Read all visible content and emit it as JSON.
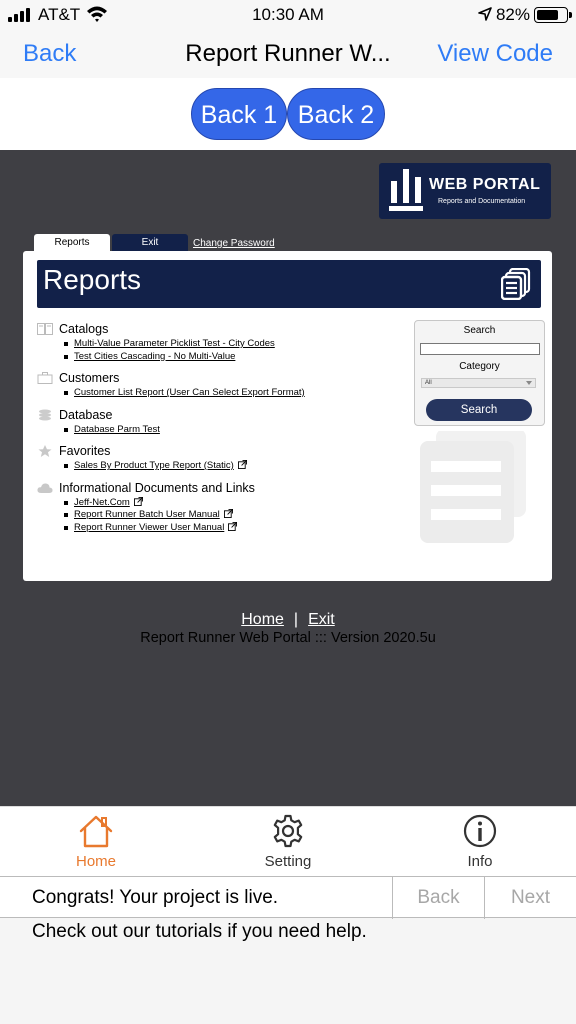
{
  "status_bar": {
    "carrier": "AT&T",
    "time": "10:30 AM",
    "battery_percent": "82%",
    "battery_level": 0.82
  },
  "nav_bar": {
    "back_label": "Back",
    "title": "Report Runner W...",
    "view_code_label": "View Code"
  },
  "top_buttons": {
    "back1_label": "Back 1",
    "back2_label": "Back 2"
  },
  "portal": {
    "logo_title": "WEB PORTAL",
    "logo_subtitle": "Reports and Documentation",
    "tabs": {
      "reports": "Reports",
      "exit": "Exit",
      "change_password": "Change Password"
    },
    "banner_title": "Reports",
    "categories": [
      {
        "name": "Catalogs",
        "icon": "book-icon",
        "items": [
          {
            "label": "Multi-Value Parameter Picklist Test - City Codes",
            "external": false
          },
          {
            "label": "Test Cities Cascading - No Multi-Value",
            "external": false
          }
        ]
      },
      {
        "name": "Customers",
        "icon": "briefcase-icon",
        "items": [
          {
            "label": "Customer List Report (User Can Select Export Format)",
            "external": false
          }
        ]
      },
      {
        "name": "Database",
        "icon": "database-icon",
        "items": [
          {
            "label": "Database Parm Test",
            "external": false
          }
        ]
      },
      {
        "name": "Favorites",
        "icon": "star-icon",
        "items": [
          {
            "label": "Sales By Product Type Report (Static)",
            "external": true
          }
        ]
      },
      {
        "name": "Informational Documents and Links",
        "icon": "cloud-icon",
        "items": [
          {
            "label": "Jeff-Net.Com",
            "external": true
          },
          {
            "label": "Report Runner Batch User Manual",
            "external": true
          },
          {
            "label": "Report Runner Viewer User Manual",
            "external": true
          }
        ]
      }
    ],
    "search": {
      "search_label": "Search",
      "search_value": "",
      "category_label": "Category",
      "category_selected": "All",
      "search_button": "Search"
    },
    "footer": {
      "home_link": "Home",
      "separator": "|",
      "exit_link": "Exit",
      "version": "Report Runner Web Portal ::: Version 2020.5u"
    }
  },
  "tab_bar": {
    "items": [
      {
        "label": "Home",
        "icon": "house-icon",
        "active": true
      },
      {
        "label": "Setting",
        "icon": "gear-icon",
        "active": false
      },
      {
        "label": "Info",
        "icon": "info-icon",
        "active": false
      }
    ],
    "active_color": "#e8792e",
    "inactive_color": "#333333"
  },
  "tutorial": {
    "message": "Congrats! Your project is live.",
    "back_label": "Back",
    "next_label": "Next",
    "help_text": "Check out our tutorials if you need help."
  },
  "colors": {
    "ios_blue": "#2f7cf6",
    "pill_blue": "#3467e8",
    "portal_navy": "#122149",
    "webview_bg": "#3f3f44"
  }
}
